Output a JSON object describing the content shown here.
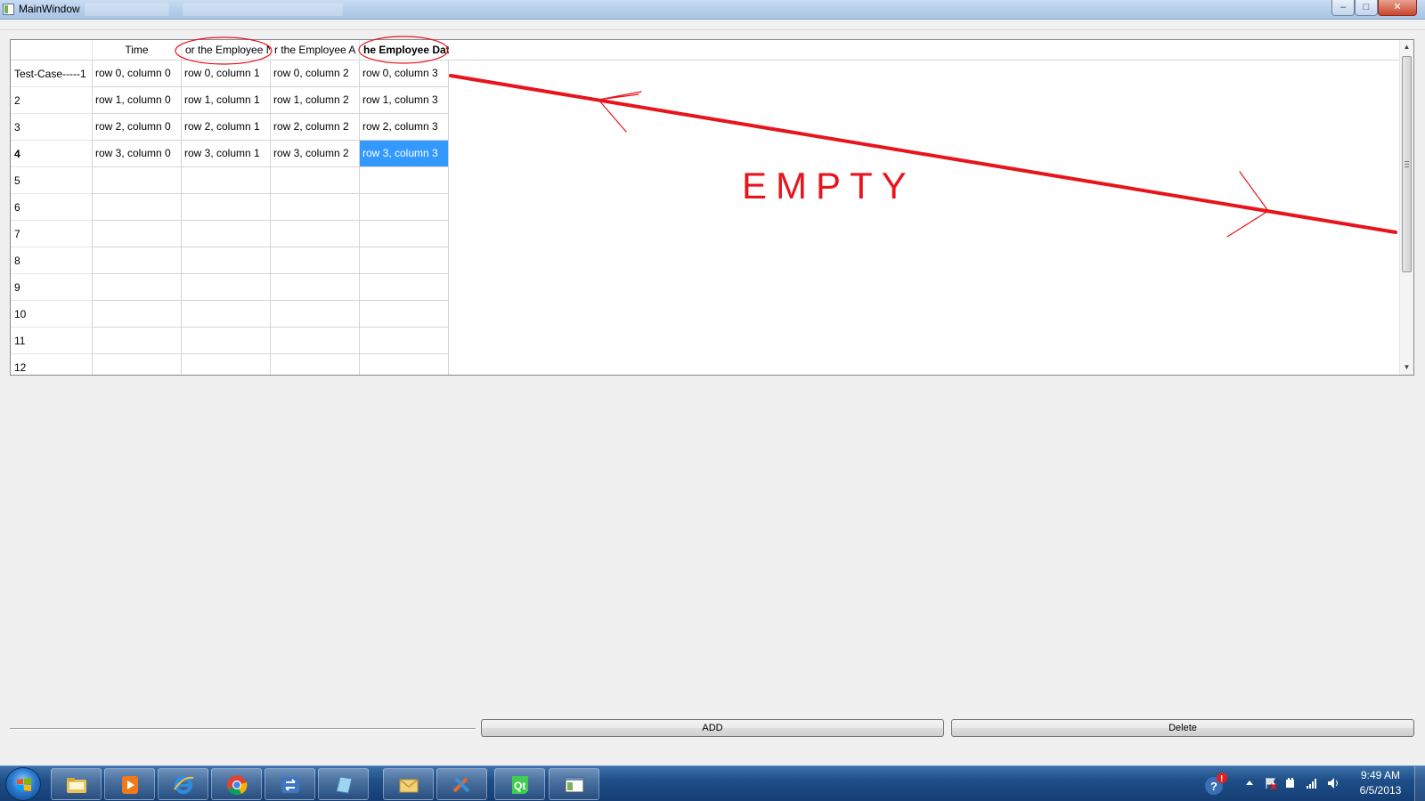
{
  "window": {
    "title": "MainWindow",
    "controls": {
      "minimize": "–",
      "maximize": "□",
      "close": "✕"
    }
  },
  "table": {
    "columns": [
      "Time",
      "or the Employee N",
      "r the Employee A",
      "he Employee Dat"
    ],
    "row_headers": [
      "Test-Case-----1",
      "2",
      "3",
      "4",
      "5",
      "6",
      "7",
      "8",
      "9",
      "10",
      "11",
      "12"
    ],
    "rows": [
      [
        "row 0, column 0",
        "row 0, column 1",
        "row 0, column 2",
        "row 0, column 3"
      ],
      [
        "row 1, column 0",
        "row 1, column 1",
        "row 1, column 2",
        "row 1, column 3"
      ],
      [
        "row 2, column 0",
        "row 2, column 1",
        "row 2, column 2",
        "row 2, column 3"
      ],
      [
        "row 3, column 0",
        "row 3, column 1",
        "row 3, column 2",
        "row 3, column 3"
      ],
      [
        "",
        "",
        "",
        ""
      ],
      [
        "",
        "",
        "",
        ""
      ],
      [
        "",
        "",
        "",
        ""
      ],
      [
        "",
        "",
        "",
        ""
      ],
      [
        "",
        "",
        "",
        ""
      ],
      [
        "",
        "",
        "",
        ""
      ],
      [
        "",
        "",
        "",
        ""
      ],
      [
        "",
        "",
        "",
        ""
      ]
    ],
    "selected": {
      "row": 3,
      "column": 3
    },
    "scroll_up": "▲",
    "scroll_down": "▼"
  },
  "annotation": {
    "text": "EMPTY",
    "color": "#e8141c"
  },
  "buttons": {
    "add": "ADD",
    "delete": "Delete"
  },
  "taskbar": {
    "items": [
      "folder-icon",
      "media-player-icon",
      "internet-explorer-icon",
      "chrome-icon",
      "remote-icon",
      "notepad-icon",
      "outlook-icon",
      "tools-icon",
      "qt-creator-icon",
      "app-window-icon"
    ],
    "clock_time": "9:49 AM",
    "clock_date": "6/5/2013"
  }
}
